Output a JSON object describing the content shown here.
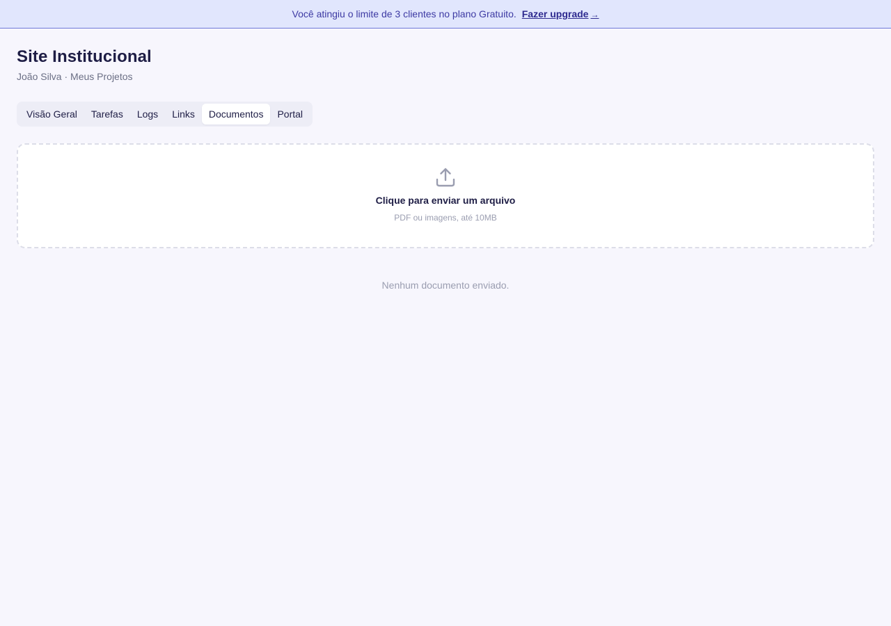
{
  "banner": {
    "message": "Você atingiu o limite de 3 clientes no plano Gratuito.",
    "upgrade_label": "Fazer upgrade",
    "upgrade_arrow": "→"
  },
  "header": {
    "title": "Site Institucional",
    "breadcrumb": "João Silva · Meus Projetos"
  },
  "tabs": [
    {
      "label": "Visão Geral"
    },
    {
      "label": "Tarefas"
    },
    {
      "label": "Logs"
    },
    {
      "label": "Links"
    },
    {
      "label": "Documentos",
      "active": true
    },
    {
      "label": "Portal"
    }
  ],
  "dropzone": {
    "icon": "upload-icon",
    "title": "Clique para enviar um arquivo",
    "hint": "PDF ou imagens, até 10MB"
  },
  "documents": {
    "empty_message": "Nenhum documento enviado."
  },
  "colors": {
    "banner_bg": "#e1e6fd",
    "accent": "#3d3aa3",
    "page_bg": "#f7f6fd"
  }
}
